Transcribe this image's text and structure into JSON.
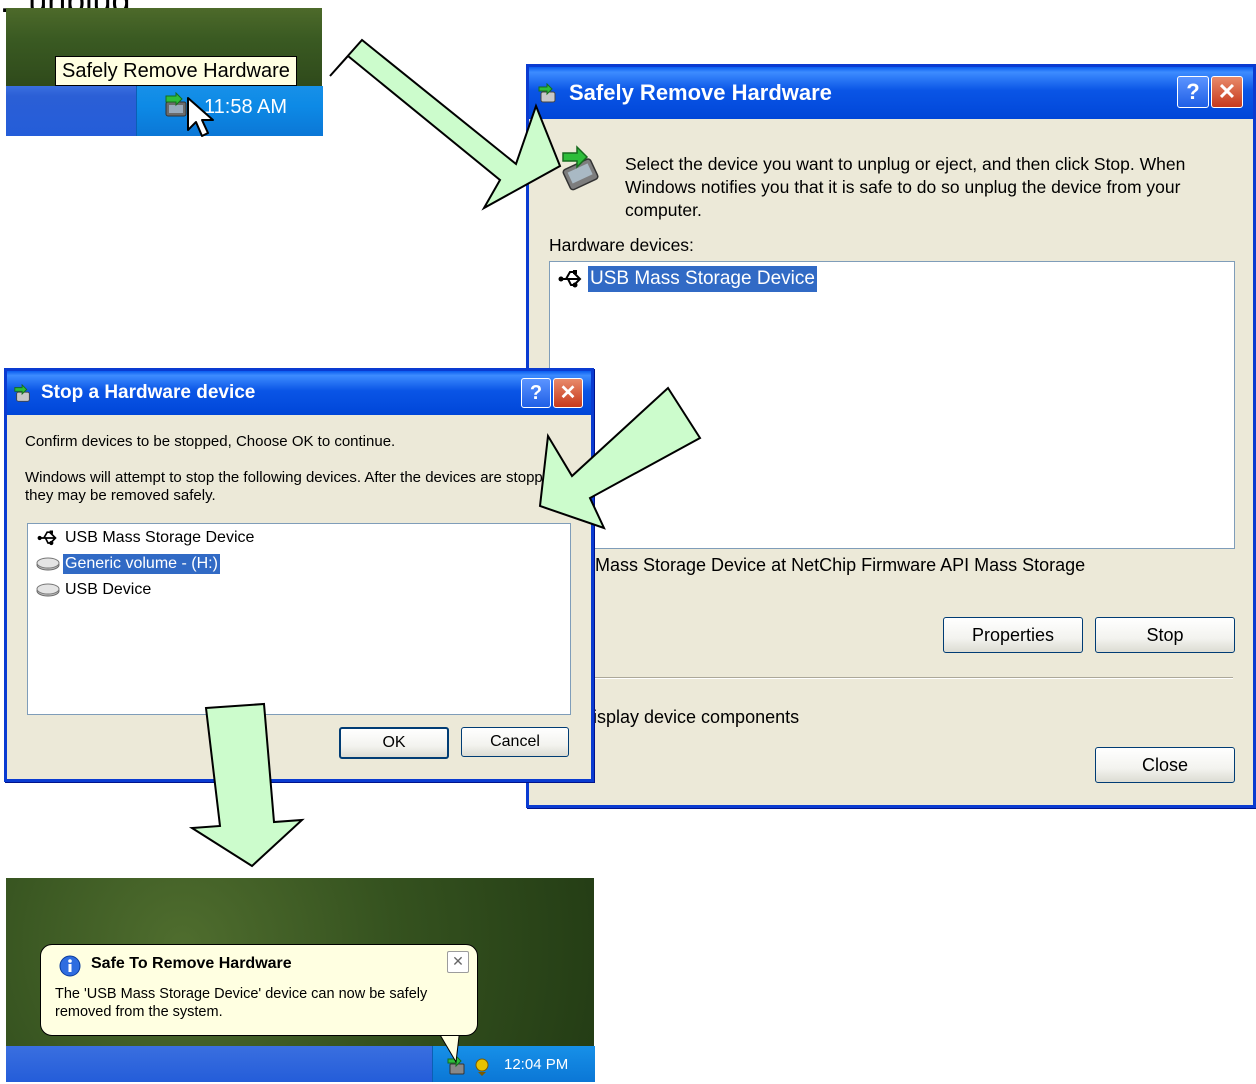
{
  "heading": {
    "text": "...unplug..."
  },
  "step1": {
    "tooltip": "Safely Remove Hardware",
    "clock": "11:58 AM"
  },
  "main_dialog": {
    "title": "Safely Remove Hardware",
    "help_label": "?",
    "close_label": "✕",
    "instructions": "Select the device you want to unplug or eject, and then click Stop. When Windows notifies you that it is safe to do so unplug the device from your computer.",
    "hardware_label": "Hardware devices:",
    "devices": [
      "USB Mass Storage Device"
    ],
    "description": "Mass Storage Device at NetChip Firmware API Mass Storage",
    "properties_label": "Properties",
    "stop_label": "Stop",
    "display_components_label": "isplay device components",
    "close_button_label": "Close"
  },
  "stop_dialog": {
    "title": "Stop a Hardware device",
    "help_label": "?",
    "close_label": "✕",
    "confirm_text": "Confirm devices to be stopped, Choose OK to continue.",
    "warning_text": "Windows will attempt to stop the following devices. After the devices are stopped they may be removed safely.",
    "items": [
      "USB Mass Storage Device",
      "Generic volume - (H:)",
      "USB Device"
    ],
    "ok_label": "OK",
    "cancel_label": "Cancel"
  },
  "notification": {
    "title": "Safe To Remove Hardware",
    "message": "The 'USB Mass Storage Device' device can now be safely removed from the system.",
    "close_label": "✕",
    "clock": "12:04 PM"
  },
  "colors": {
    "arrow_fill": "#ccfccc",
    "titlebar_blue": "#0a55e6",
    "selection": "#316ac5",
    "dialog_face": "#ece9d8",
    "balloon": "#ffffe1"
  }
}
